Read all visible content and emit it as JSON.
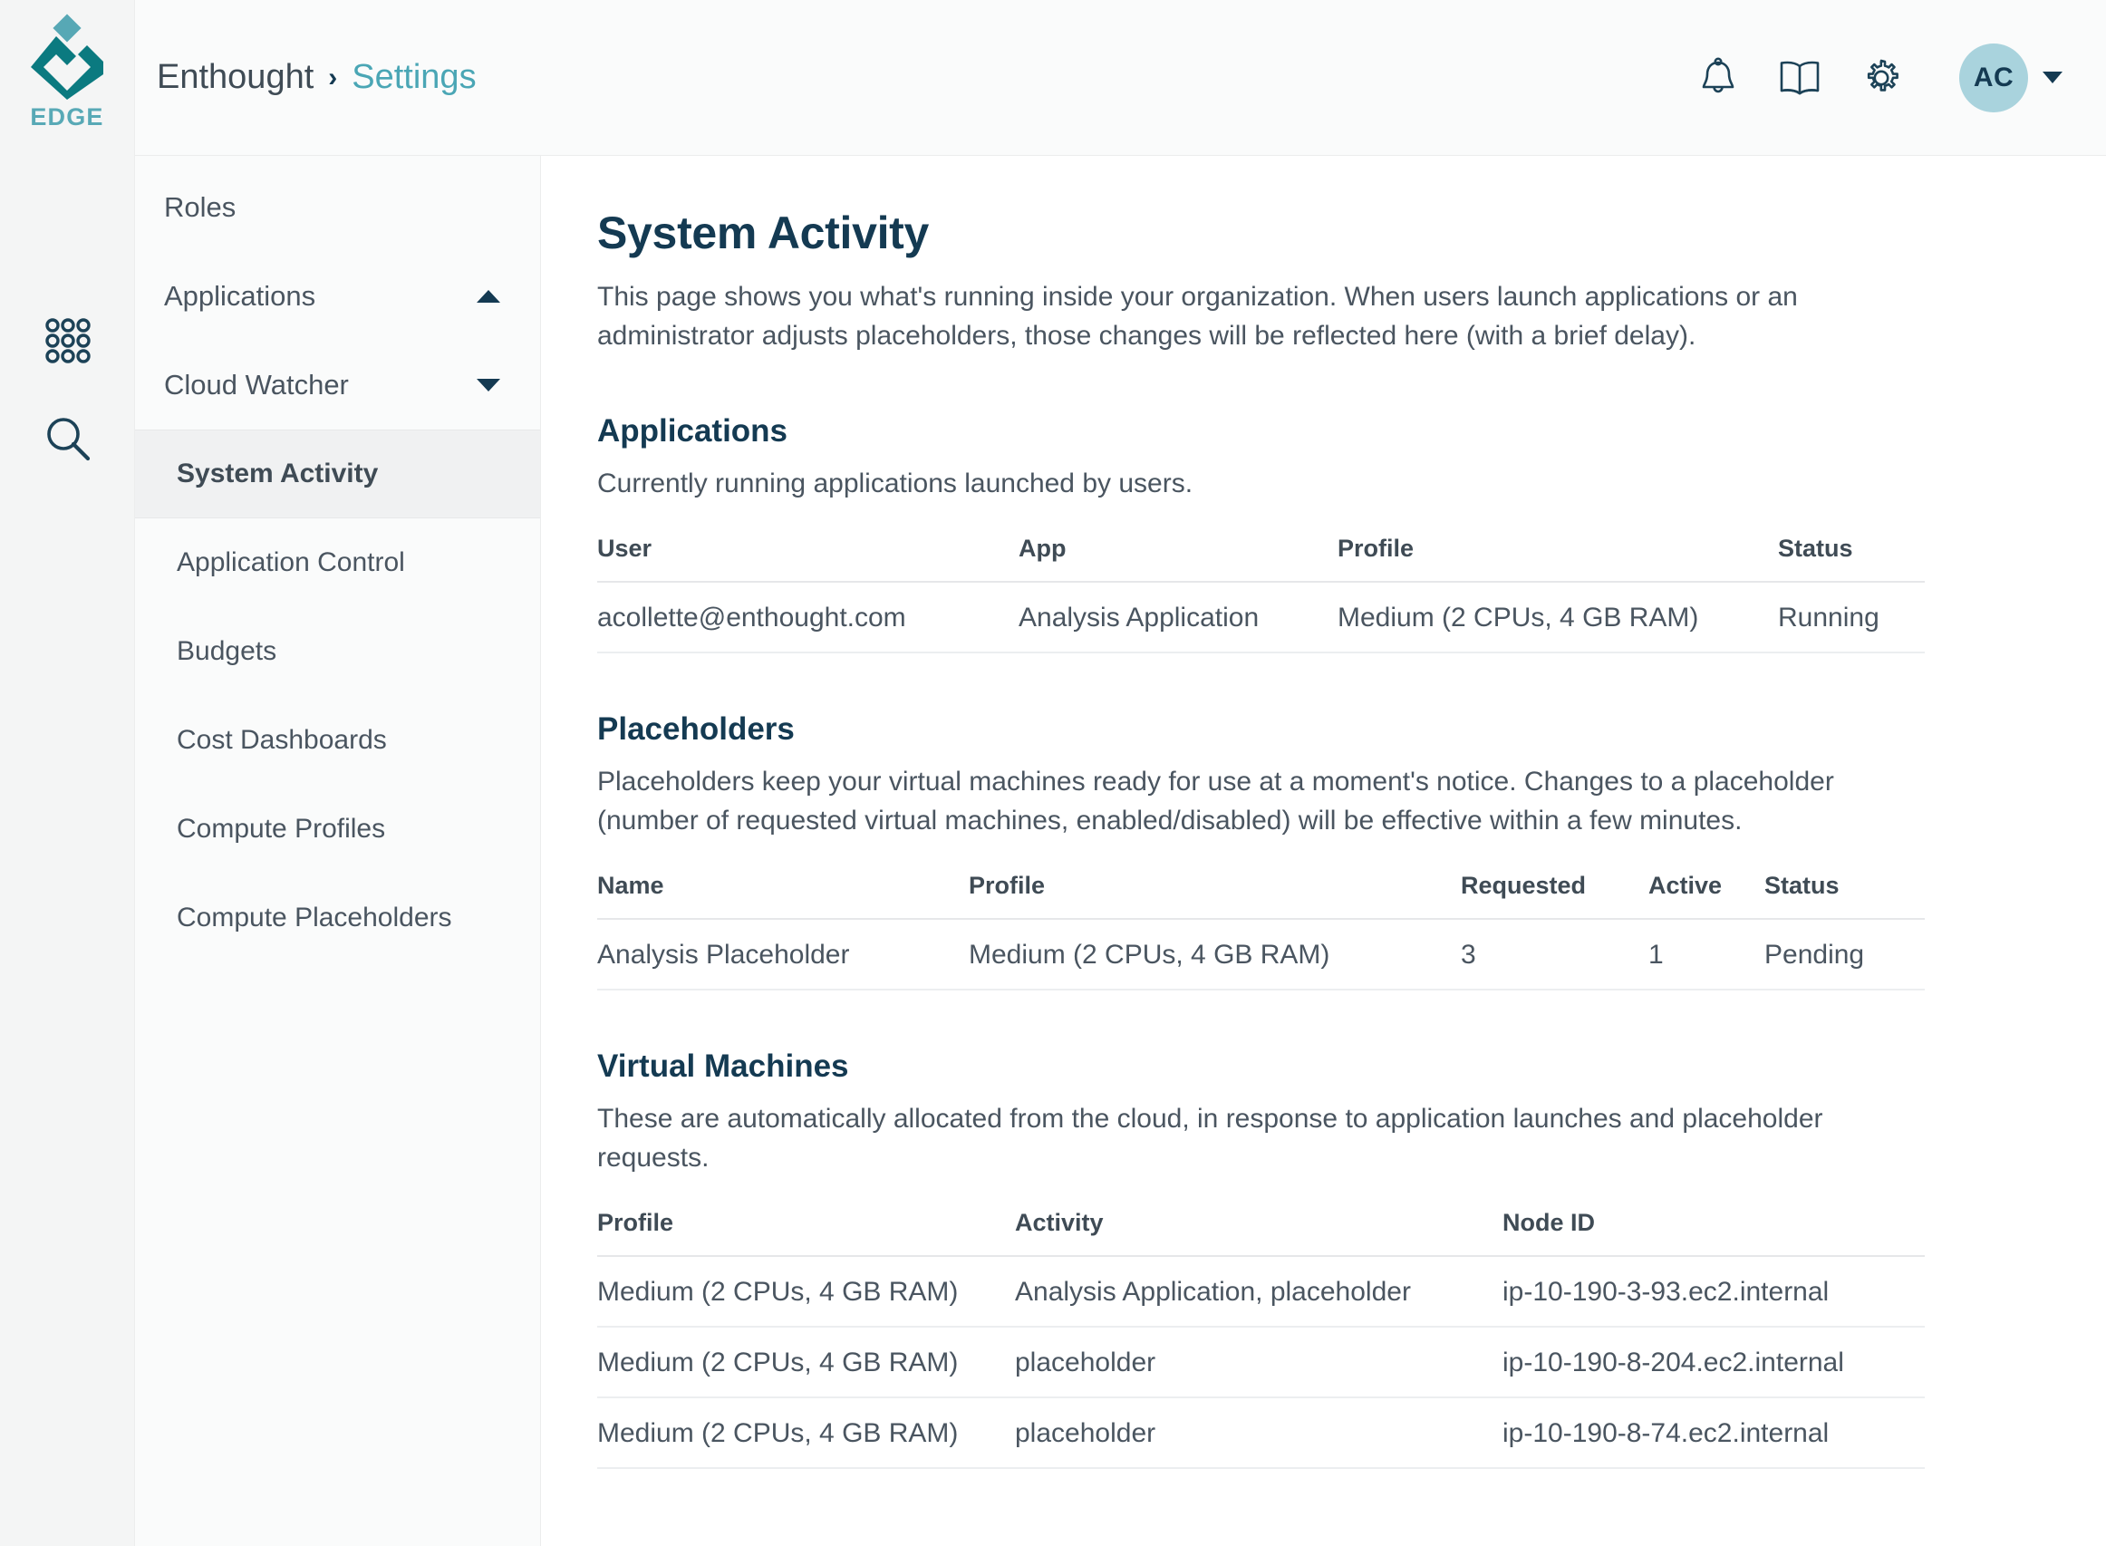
{
  "brand": {
    "logo_icon": "enthought-diamond-logo",
    "product_name": "EDGE",
    "teal_dark": "#0b7a80",
    "teal_light": "#58a9b6"
  },
  "rail": {
    "icons": [
      {
        "name": "apps-grid-icon"
      },
      {
        "name": "search-icon"
      }
    ]
  },
  "header": {
    "breadcrumb": {
      "org": "Enthought",
      "separator": "›",
      "current": "Settings"
    },
    "actions": [
      {
        "name": "notifications-bell-icon"
      },
      {
        "name": "documentation-book-icon"
      },
      {
        "name": "settings-gear-icon"
      }
    ],
    "avatar": {
      "initials": "AC",
      "background": "#a9d3dd"
    }
  },
  "sidebar": {
    "items": [
      {
        "label": "Roles",
        "level": "top",
        "expander": null,
        "active": false
      },
      {
        "label": "Applications",
        "level": "top",
        "expander": "chevron-up-icon",
        "active": false
      },
      {
        "label": "Cloud Watcher",
        "level": "top",
        "expander": "chevron-down-icon",
        "active": false
      },
      {
        "label": "System Activity",
        "level": "sub",
        "expander": null,
        "active": true
      },
      {
        "label": "Application Control",
        "level": "sub",
        "expander": null,
        "active": false
      },
      {
        "label": "Budgets",
        "level": "sub",
        "expander": null,
        "active": false
      },
      {
        "label": "Cost Dashboards",
        "level": "sub",
        "expander": null,
        "active": false
      },
      {
        "label": "Compute Profiles",
        "level": "sub",
        "expander": null,
        "active": false
      },
      {
        "label": "Compute Placeholders",
        "level": "sub",
        "expander": null,
        "active": false
      }
    ]
  },
  "main": {
    "title": "System Activity",
    "intro": "This page shows you what's running inside your organization. When users launch applications or an administrator adjusts placeholders, those changes will be reflected here (with a brief delay).",
    "applications": {
      "title": "Applications",
      "description": "Currently running applications launched by users.",
      "columns": [
        "User",
        "App",
        "Profile",
        "Status"
      ],
      "rows": [
        [
          "acollette@enthought.com",
          "Analysis Application",
          "Medium (2 CPUs, 4 GB RAM)",
          "Running"
        ]
      ]
    },
    "placeholders": {
      "title": "Placeholders",
      "description": "Placeholders keep your virtual machines ready for use at a moment's notice. Changes to a placeholder (number of requested virtual machines, enabled/disabled) will be effective within a few minutes.",
      "columns": [
        "Name",
        "Profile",
        "Requested",
        "Active",
        "Status"
      ],
      "rows": [
        [
          "Analysis Placeholder",
          "Medium (2 CPUs, 4 GB RAM)",
          "3",
          "1",
          "Pending"
        ]
      ]
    },
    "virtual_machines": {
      "title": "Virtual Machines",
      "description": "These are automatically allocated from the cloud, in response to application launches and placeholder requests.",
      "columns": [
        "Profile",
        "Activity",
        "Node ID"
      ],
      "rows": [
        [
          "Medium (2 CPUs, 4 GB RAM)",
          "Analysis Application, placeholder",
          "ip-10-190-3-93.ec2.internal"
        ],
        [
          "Medium (2 CPUs, 4 GB RAM)",
          "placeholder",
          "ip-10-190-8-204.ec2.internal"
        ],
        [
          "Medium (2 CPUs, 4 GB RAM)",
          "placeholder",
          "ip-10-190-8-74.ec2.internal"
        ]
      ]
    }
  }
}
